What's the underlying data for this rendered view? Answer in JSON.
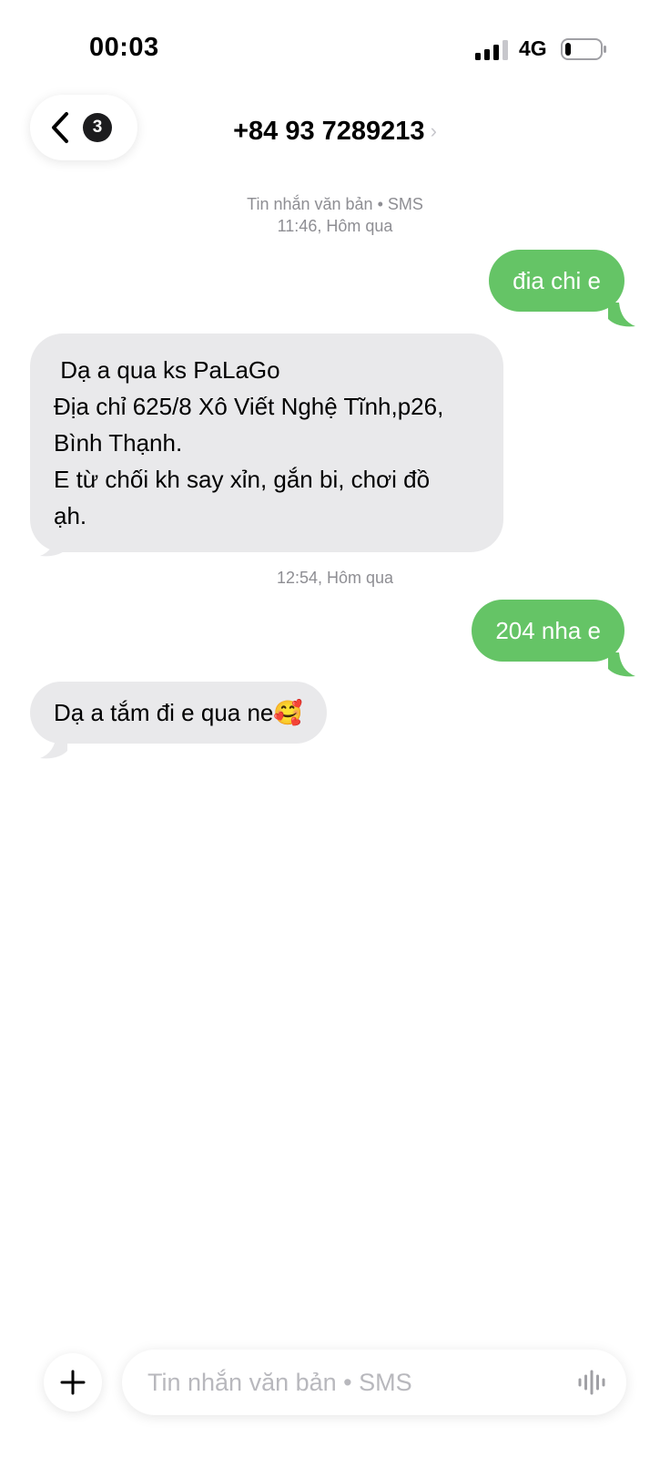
{
  "status_bar": {
    "time": "00:03",
    "network": "4G"
  },
  "header": {
    "back_badge_count": "3",
    "contact": "+84 93 7289213",
    "chevron": "›"
  },
  "thread": {
    "meta_1_type": "Tin nhắn văn bản • SMS",
    "meta_1_time": "11:46, Hôm qua",
    "msg_1": "đia chi e",
    "msg_2_lines": [
      " Dạ a qua ks PaLaGo",
      "Địa chỉ 625/8 Xô Viết Nghệ Tĩnh,p26,",
      "Bình Thạnh.",
      "E từ chối kh say xỉn, gắn bi, chơi đồ",
      "ạh."
    ],
    "meta_2_time": "12:54, Hôm qua",
    "msg_3": "204 nha e",
    "msg_4": "Dạ a tắm đi e qua ne🥰"
  },
  "composer": {
    "placeholder": "Tin nhắn văn bản • SMS"
  },
  "colors": {
    "outgoing_bubble": "#65c466",
    "incoming_bubble": "#e9e9eb",
    "meta_text": "#8e8e93"
  },
  "icons": {
    "back": "chevron-left-icon",
    "add": "plus-icon",
    "voice": "waveform-icon",
    "signal": "cellular-signal-icon",
    "battery": "battery-icon"
  }
}
